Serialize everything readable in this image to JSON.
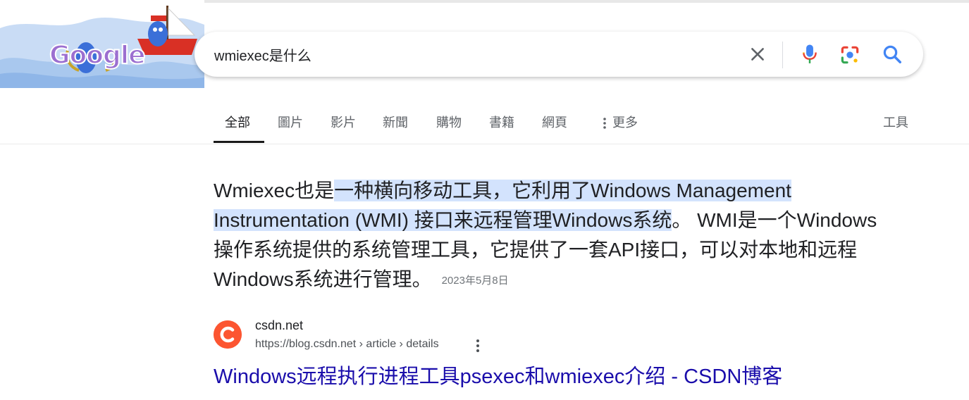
{
  "doodle": {
    "logo_text": "Google",
    "icon": "google-doodle-boat-bird"
  },
  "search": {
    "query": "wmiexec是什么",
    "icons": [
      "close-icon",
      "mic-icon",
      "google-lens-icon",
      "search-icon"
    ]
  },
  "tabs": {
    "items": [
      "全部",
      "圖片",
      "影片",
      "新聞",
      "購物",
      "書籍",
      "網頁"
    ],
    "more_label": "更多",
    "active": "全部",
    "tools_label": "工具"
  },
  "snippet": {
    "pre": "Wmiexec也是",
    "highlighted": "一种横向移动工具，它利用了Windows Management Instrumentation (WMI) 接口来远程管理Windows系统",
    "post": "。 WMI是一个Windows操作系统提供的系统管理工具，它提供了一套API接口，可以对本地和远程Windows系统进行管理。",
    "date": "2023年5月8日"
  },
  "result": {
    "site_name": "csdn.net",
    "url": "https://blog.csdn.net › article › details",
    "title": "Windows远程执行进程工具psexec和wmiexec介绍 - CSDN博客",
    "favicon_letter": "C"
  },
  "colors": {
    "link": "#1a0dab",
    "highlight": "#d3e3fd",
    "csdn": "#fc5531",
    "google_blue": "#4285f4",
    "google_red": "#ea4335",
    "google_yellow": "#fbbc04",
    "google_green": "#34a853"
  }
}
